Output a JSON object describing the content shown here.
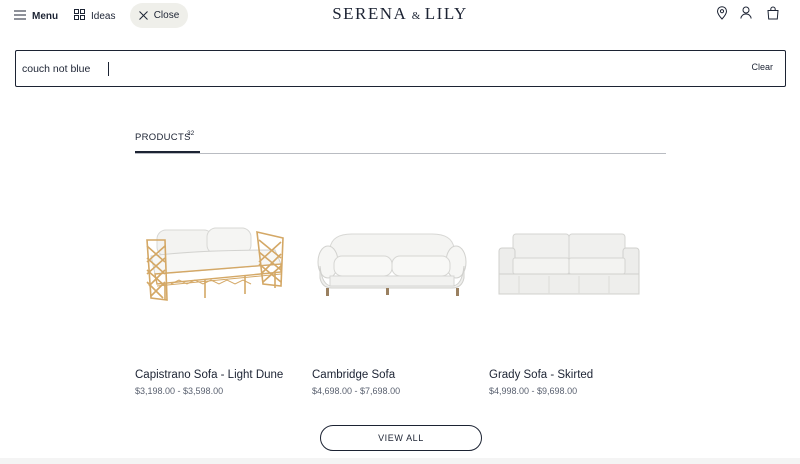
{
  "header": {
    "menu_label": "Menu",
    "ideas_label": "Ideas",
    "close_label": "Close",
    "logo_left": "SERENA",
    "logo_amp": "&",
    "logo_right": "LILY"
  },
  "search": {
    "value": "couch not blue",
    "clear_label": "Clear"
  },
  "tabs": {
    "products_label": "PRODUCTS",
    "products_count": "32"
  },
  "products": [
    {
      "name": "Capistrano Sofa - Light Dune",
      "price": "$3,198.00 - $3,598.00"
    },
    {
      "name": "Cambridge Sofa",
      "price": "$4,698.00 - $7,698.00"
    },
    {
      "name": "Grady Sofa - Skirted",
      "price": "$4,998.00 - $9,698.00"
    }
  ],
  "view_all_label": "VIEW ALL",
  "colors": {
    "ink": "#1c2333",
    "close_pill": "#efefea",
    "rattan": "#d9b27a",
    "cushion": "#f2f2f0"
  }
}
